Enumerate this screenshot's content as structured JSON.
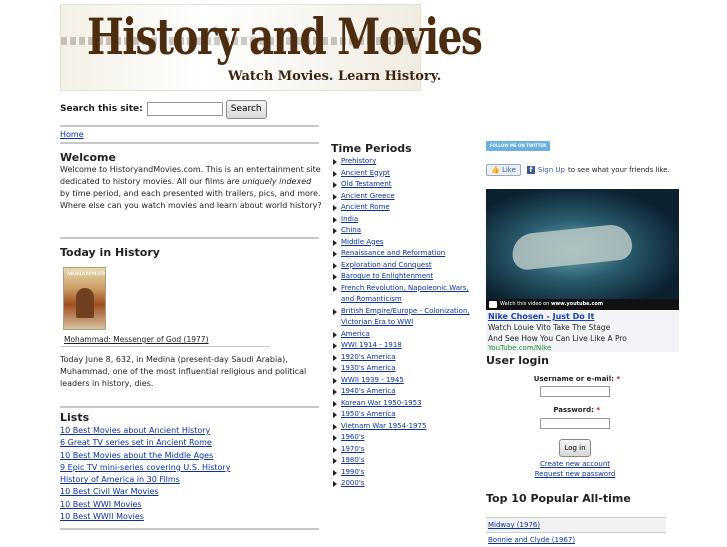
{
  "logo": {
    "title": "History and Movies",
    "tagline": "Watch Movies. Learn History."
  },
  "search": {
    "label": "Search this site:",
    "value": "",
    "button": "Search"
  },
  "breadcrumb": {
    "home": "Home"
  },
  "welcome": {
    "title": "Welcome",
    "text_before": "Welcome to HistoryandMovies.com. This is an entertainment site dedicated to history movies. All our films are ",
    "emphasis": "uniquely indexed",
    "text_after": " by time period, and each presented with trailers, pics, and more. Where else can you watch movies and learn about world history?"
  },
  "today": {
    "title": "Today in History",
    "poster_text": "MOHAMMAD",
    "movie_link": "Mohammad: Messenger of God (1977)",
    "text": "Today June 8, 632, in Medina (present-day Saudi Arabia), Muhammad, one of the most influential religious and political leaders in history, dies."
  },
  "lists": {
    "title": "Lists",
    "items": [
      "10 Best Movies about Ancient History",
      "6 Great TV series set in Ancient Rome",
      "10 Best Movies about the Middle Ages",
      "9 Epic TV mini-series covering U.S. History",
      "History of America in 30 Films",
      "10 Best Civil War Movies",
      "10 Best WWI Movies",
      "10 Best WWII Movies"
    ]
  },
  "time_periods": {
    "title": "Time Periods",
    "items": [
      "Prehistory",
      "Ancient Egypt",
      "Old Testament",
      "Ancient Greece",
      "Ancient Rome",
      "India",
      "China",
      "Middle Ages",
      "Renaissance and Reformation",
      "Exploration and Conquest",
      "Baroque to Enlightenment",
      "French Revolution, Napoleonic Wars, and Romanticism",
      "British Empire/Europe - Colonization, Victorian Era to WWI",
      "America",
      "WWI 1914 - 1918",
      "1920's America",
      "1930's America",
      "WWII 1939 - 1945",
      "1940's America",
      "Korean War 1950-1953",
      "1950's America",
      "Vietnam War 1954-1975",
      "1960's",
      "1970's",
      "1980's",
      "1990's",
      "2000's"
    ]
  },
  "social": {
    "twitter": "FOLLOW ME ON TWITTER",
    "like": "Like",
    "signup": "Sign Up",
    "signup_suffix": "to see what your friends like."
  },
  "video": {
    "caption_prefix": "Watch this video on",
    "caption_site": "www.youtube.com"
  },
  "ad": {
    "title": "Nike Chosen - Just Do It",
    "line1": "Watch Louie Vito Take The Stage",
    "line2": "And See How You Can Live Like A Pro",
    "url": "YouTube.com/Nike"
  },
  "login": {
    "title": "User login",
    "username_label": "Username or e-mail:",
    "password_label": "Password:",
    "required_mark": "*",
    "button": "Log in",
    "create_account": "Create new account",
    "request_password": "Request new password"
  },
  "popular": {
    "title": "Top 10 Popular All-time",
    "items": [
      "Midway (1976)",
      "Bonnie and Clyde (1967)"
    ]
  },
  "colors": {
    "link": "#0a32a0",
    "logo_brown": "#4d2d0f",
    "twitter_blue": "#6ab0e0",
    "facebook_blue": "#3b5998",
    "required_red": "#cc0000"
  }
}
